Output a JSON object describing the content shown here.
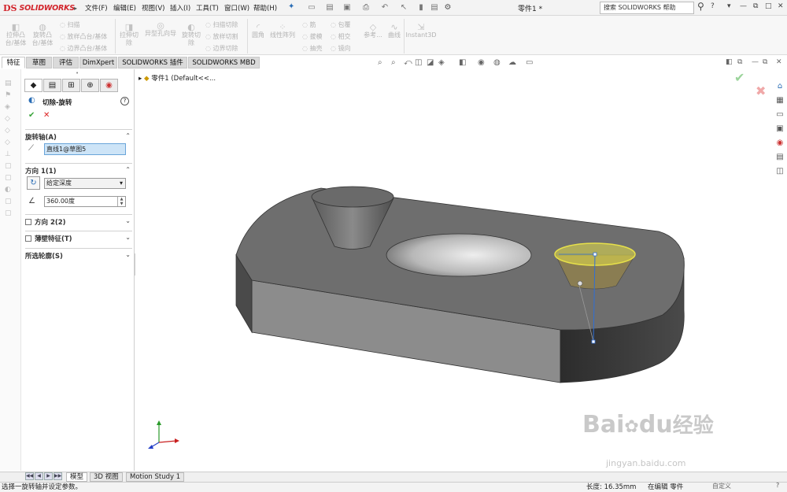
{
  "app": {
    "logo_ds": "DS",
    "logo_text": "SOLIDWORKS",
    "doc_title": "零件1 *"
  },
  "menu": [
    "文件(F)",
    "编辑(E)",
    "视图(V)",
    "插入(I)",
    "工具(T)",
    "窗口(W)",
    "帮助(H)"
  ],
  "search": {
    "placeholder": "搜索 SOLIDWORKS 帮助"
  },
  "commands": {
    "extrude_boss": "拉伸凸\n台/基体",
    "revolve_boss": "旋转凸\n台/基体",
    "sweep": "扫描",
    "loft": "放样凸台/基体",
    "boundary": "边界凸台/基体",
    "extrude_cut": "拉伸切\n除",
    "hole_wizard": "异型孔向导",
    "revolve_cut": "旋转切\n除",
    "swept_cut": "扫描切除",
    "lofted_cut": "放样切割",
    "boundary_cut": "边界切除",
    "fillet": "圆角",
    "linear_pattern": "线性阵列",
    "rib": "筋",
    "draft": "拔模",
    "shell": "抽壳",
    "wrap": "包覆",
    "intersect": "相交",
    "mirror": "镜向",
    "ref_geom": "参考...",
    "curves": "曲线",
    "instant3d": "Instant3D"
  },
  "tabs": [
    "特征",
    "草图",
    "评估",
    "DimXpert",
    "SOLIDWORKS 插件",
    "SOLIDWORKS MBD"
  ],
  "tree": {
    "root": "零件1  (Default<<..."
  },
  "pm": {
    "title": "切除-旋转",
    "help": "?",
    "axis_group": "旋转轴(A)",
    "axis_value": "直线1@草图5",
    "dir1_group": "方向 1(1)",
    "end_condition": "给定深度",
    "angle": "360.00度",
    "dir2_group": "方向 2(2)",
    "thin_group": "薄壁特征(T)",
    "contours_group": "所选轮廓(S)"
  },
  "bottom_tabs": [
    "模型",
    "3D 视图",
    "Motion Study 1"
  ],
  "status": {
    "message": "选择一旋转轴并设定参数。",
    "length": "长度: 16.35mm",
    "mode": "在编辑 零件",
    "custom": "自定义"
  },
  "watermark": {
    "brand": "Bai",
    "brand2": "du",
    "brand3": "经验",
    "url": "jingyan.baidu.com"
  },
  "colors": {
    "accent_red": "#d2232a",
    "model_gray": "#6e6e6e",
    "sketch_yellow": "#e6e04a",
    "sketch_blue": "#2f6fd6"
  }
}
